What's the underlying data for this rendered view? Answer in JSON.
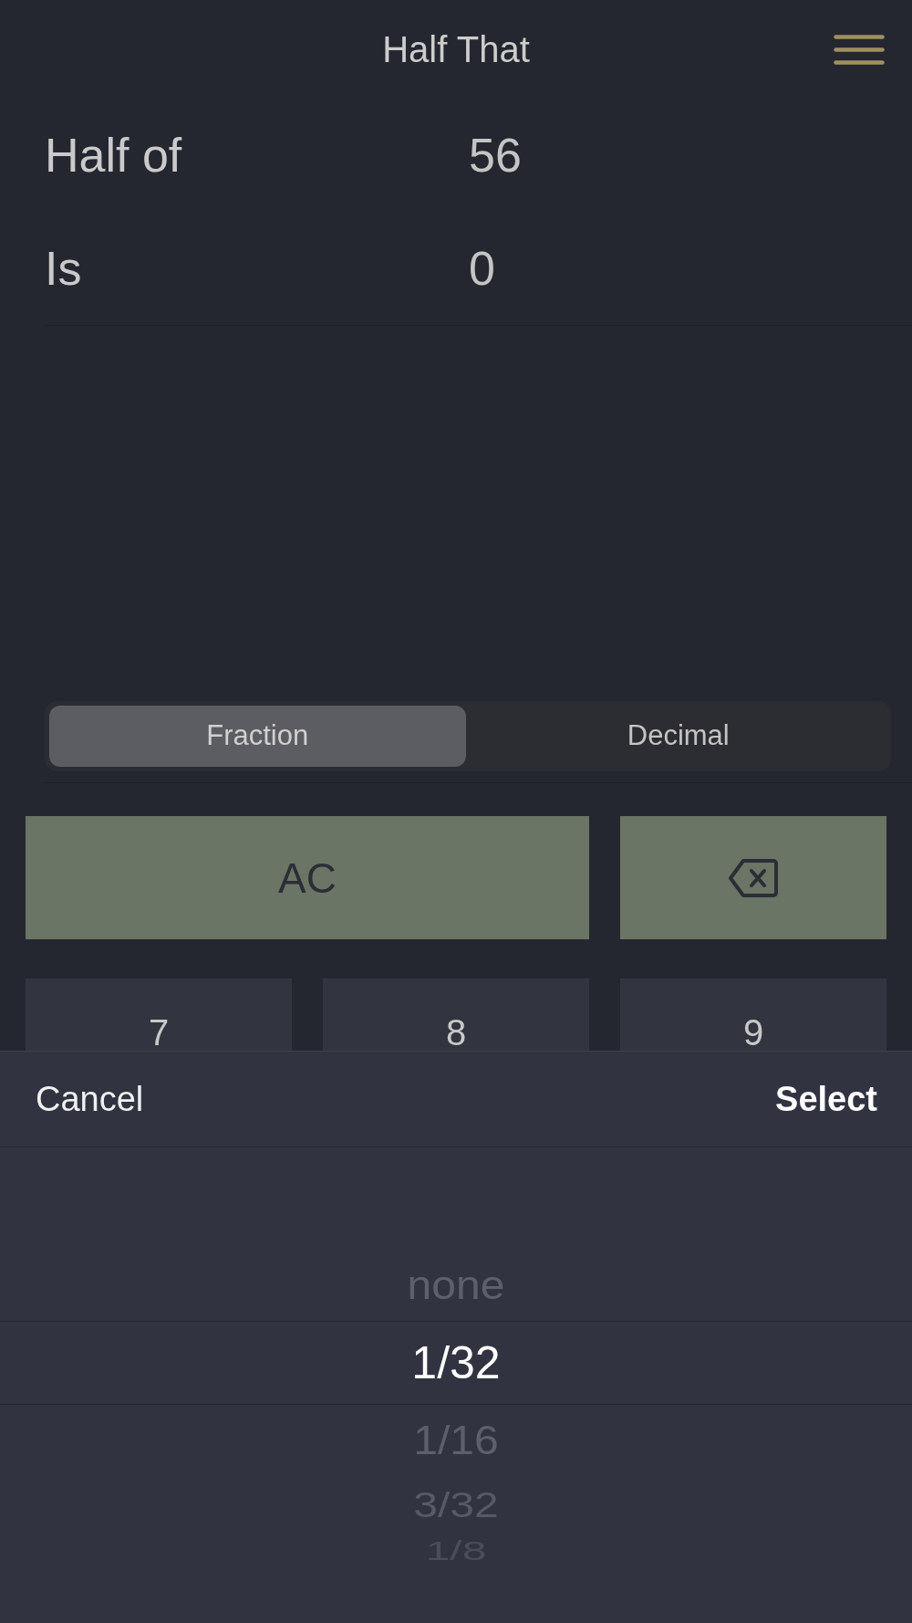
{
  "header": {
    "title": "Half That"
  },
  "rows": [
    {
      "label": "Half of",
      "value": "56"
    },
    {
      "label": "Is",
      "value": "0"
    }
  ],
  "mode_tabs": [
    {
      "label": "Fraction",
      "selected": true
    },
    {
      "label": "Decimal",
      "selected": false
    }
  ],
  "keypad": [
    {
      "kind": "clear",
      "label": "AC"
    },
    {
      "kind": "backspace"
    },
    {
      "kind": "digit",
      "label": "7"
    },
    {
      "kind": "digit",
      "label": "8"
    },
    {
      "kind": "digit",
      "label": "9"
    }
  ],
  "picker_sheet": {
    "cancel": "Cancel",
    "confirm": "Select",
    "options": [
      {
        "label": "none",
        "selected": false
      },
      {
        "label": "1/32",
        "selected": true
      },
      {
        "label": "1/16",
        "selected": false
      },
      {
        "label": "3/32",
        "selected": false
      },
      {
        "label": "1/8",
        "selected": false
      }
    ]
  }
}
